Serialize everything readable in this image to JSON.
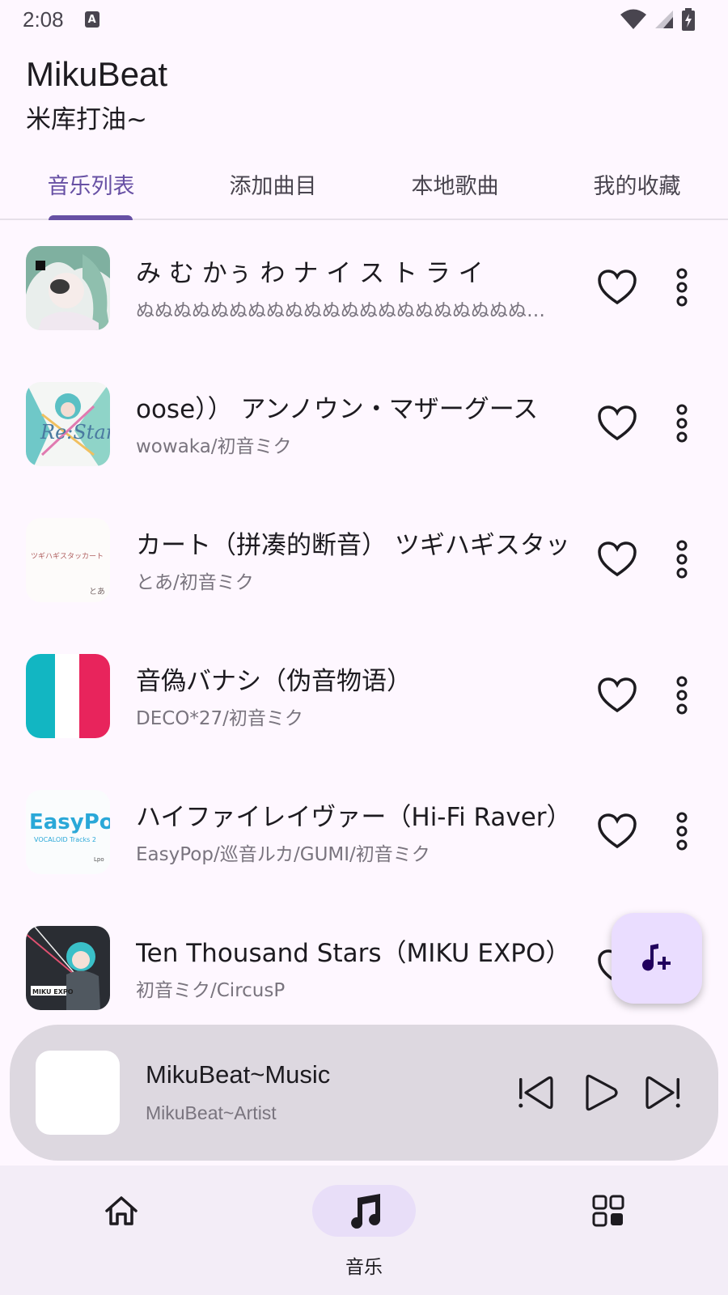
{
  "status_bar": {
    "time": "2:08",
    "notification_icon": "A"
  },
  "header": {
    "title": "MikuBeat",
    "subtitle": "米库打油~"
  },
  "tabs": [
    {
      "label": "音乐列表",
      "active": true
    },
    {
      "label": "添加曲目",
      "active": false
    },
    {
      "label": "本地歌曲",
      "active": false
    },
    {
      "label": "我的收藏",
      "active": false
    }
  ],
  "songs": [
    {
      "title": "み む かぅ わ ナ イ ス ト ラ イ",
      "artist": "ぬぬぬぬぬぬぬぬぬぬぬぬぬぬぬぬぬぬぬぬぬぬぬぬぬぬぬぬ",
      "favorite": false,
      "icon": "heart-outline"
    },
    {
      "title": "oose））                    アンノウン・マザーグース",
      "artist": "wowaka/初音ミク",
      "favorite": false,
      "icon": "heart-outline"
    },
    {
      "title": "カート（拼凑的断音）                  ツギハギスタッカート",
      "artist": "とあ/初音ミク",
      "favorite": false,
      "icon": "heart-outline"
    },
    {
      "title": "音偽バナシ（伪音物语）",
      "artist": "DECO*27/初音ミク",
      "favorite": false,
      "icon": "heart-outline"
    },
    {
      "title": "ハイファイレイヴァー（Hi-Fi Raver）",
      "artist": "EasyPop/巡音ルカ/GUMI/初音ミク",
      "favorite": false,
      "icon": "heart-outline"
    },
    {
      "title": "             Ten Thousand Stars（MIKU EXPO）",
      "artist": "初音ミク/CircusP",
      "favorite": false,
      "icon": "heart-outline"
    }
  ],
  "fab": {
    "icon": "add-music-icon"
  },
  "player": {
    "title": "MikuBeat~Music",
    "artist": "MikuBeat~Artist",
    "controls": [
      "previous-icon",
      "play-icon",
      "next-icon"
    ]
  },
  "bottom_nav": [
    {
      "label": "",
      "icon": "home-icon",
      "active": false
    },
    {
      "label": "音乐",
      "icon": "music-note-icon",
      "active": true
    },
    {
      "label": "",
      "icon": "grid-icon",
      "active": false
    }
  ],
  "colors": {
    "background": "#fef7ff",
    "accent": "#6750a4",
    "fab": "#eaddff",
    "player_bg": "#ddd8e0",
    "nav_bg": "#f3edf7"
  }
}
